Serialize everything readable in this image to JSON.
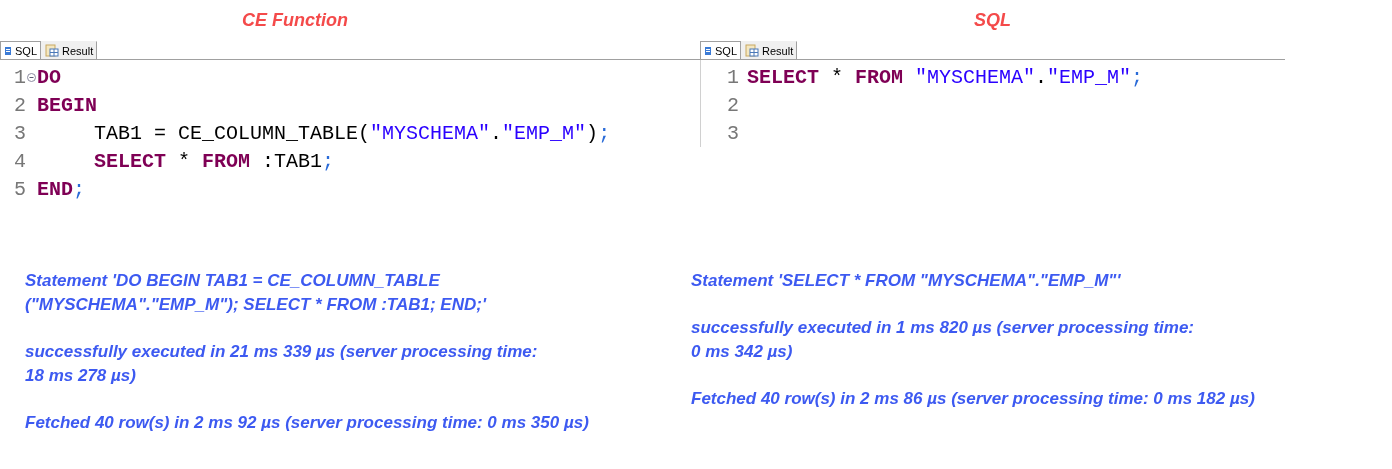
{
  "panels": [
    {
      "title": "CE Function",
      "tabs": [
        {
          "label": "SQL",
          "selected": true
        },
        {
          "label": "Result",
          "selected": false
        }
      ],
      "lines": [
        {
          "number": "1",
          "foldable": true,
          "indented": false,
          "tokens": [
            {
              "kind": "kw",
              "text": "DO"
            }
          ]
        },
        {
          "number": "2",
          "foldable": false,
          "indented": false,
          "tokens": [
            {
              "kind": "kw",
              "text": "BEGIN"
            }
          ]
        },
        {
          "number": "3",
          "foldable": false,
          "indented": true,
          "tokens": [
            {
              "kind": "plain",
              "text": "TAB1 = CE_COLUMN_TABLE("
            },
            {
              "kind": "str",
              "text": "\"MYSCHEMA\""
            },
            {
              "kind": "plain",
              "text": "."
            },
            {
              "kind": "str",
              "text": "\"EMP_M\""
            },
            {
              "kind": "plain",
              "text": ")"
            },
            {
              "kind": "semi",
              "text": ";"
            }
          ]
        },
        {
          "number": "4",
          "foldable": false,
          "indented": true,
          "tokens": [
            {
              "kind": "kw",
              "text": "SELECT"
            },
            {
              "kind": "plain",
              "text": " * "
            },
            {
              "kind": "kw",
              "text": "FROM"
            },
            {
              "kind": "plain",
              "text": " :TAB1"
            },
            {
              "kind": "semi",
              "text": ";"
            }
          ]
        },
        {
          "number": "5",
          "foldable": false,
          "indented": false,
          "tokens": [
            {
              "kind": "kw",
              "text": "END"
            },
            {
              "kind": "semi",
              "text": ";"
            }
          ]
        }
      ],
      "messages": [
        "Statement 'DO BEGIN TAB1 = CE_COLUMN_TABLE\n(\"MYSCHEMA\".\"EMP_M\"); SELECT * FROM :TAB1; END;'",
        "successfully executed in 21 ms 339 µs  (server processing time:\n18 ms 278 µs)",
        "Fetched 40 row(s) in 2 ms 92 µs (server processing time: 0 ms 350 µs)"
      ]
    },
    {
      "title": "SQL",
      "tabs": [
        {
          "label": "SQL",
          "selected": true
        },
        {
          "label": "Result",
          "selected": false
        }
      ],
      "lines": [
        {
          "number": "1",
          "foldable": false,
          "indented": false,
          "tokens": [
            {
              "kind": "kw",
              "text": "SELECT"
            },
            {
              "kind": "plain",
              "text": " * "
            },
            {
              "kind": "kw",
              "text": "FROM "
            },
            {
              "kind": "str",
              "text": "\"MYSCHEMA\""
            },
            {
              "kind": "plain",
              "text": "."
            },
            {
              "kind": "str",
              "text": "\"EMP_M\""
            },
            {
              "kind": "semi",
              "text": ";"
            }
          ]
        },
        {
          "number": "2",
          "foldable": false
        },
        {
          "number": "3",
          "foldable": false
        }
      ],
      "messages": [
        "Statement 'SELECT * FROM \"MYSCHEMA\".\"EMP_M\"'",
        "successfully executed in 1 ms 820 µs  (server processing time:\n0 ms 342 µs)",
        "Fetched 40 row(s) in 2 ms 86 µs (server processing time: 0 ms 182 µs)"
      ]
    }
  ]
}
